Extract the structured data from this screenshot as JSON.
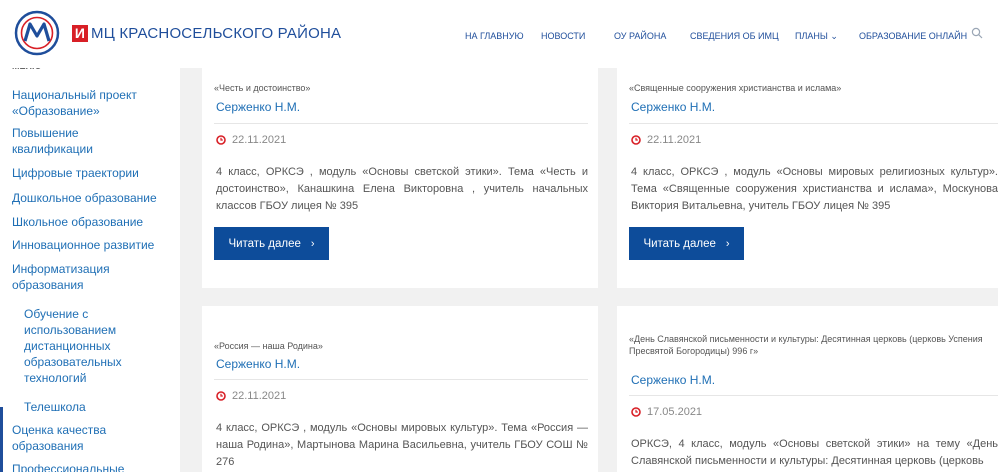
{
  "header": {
    "logo_mark": "И",
    "logo_text": "МЦ КРАСНОСЕЛЬСКОГО РАЙОНА",
    "nav": [
      "НА ГЛАВНУЮ",
      "НОВОСТИ",
      "ОУ РАЙОНА",
      "СВЕДЕНИЯ ОБ ИМЦ",
      "ПЛАНЫ ⌄",
      "ОБРАЗОВАНИЕ ОНЛАЙН"
    ],
    "search_icon": "search-icon"
  },
  "sidebar": {
    "title": "МЕНЮ",
    "items": [
      "Национальный проект «Образование»",
      "Повышение квалификации",
      "Цифровые траектории",
      "Дошкольное образование",
      "Школьное образование",
      "Инновационное развитие",
      "Информатизация образования",
      "Обучение с использованием дистанционных образовательных технологий",
      "Телешкола",
      "Оценка качества образования",
      "Профессиональные"
    ]
  },
  "cards": [
    {
      "category": "«Честь и достоинство»",
      "author": "Серженко Н.М.",
      "date": "22.11.2021",
      "text": "4 класс, ОРКСЭ , модуль «Основы светской этики». Тема «Честь и достоинство», Канашкина Елена Викторовна , учитель начальных классов ГБОУ лицея № 395",
      "button": "Читать далее"
    },
    {
      "category": "«Священные сооружения христианства и ислама»",
      "author": "Серженко Н.М.",
      "date": "22.11.2021",
      "text": "4 класс, ОРКСЭ , модуль «Основы мировых религиозных культур». Тема «Священные сооружения христианства и ислама», Москунова Виктория Витальевна, учитель ГБОУ лицея № 395",
      "button": "Читать далее"
    },
    {
      "category": "«Россия — наша Родина»",
      "author": "Серженко Н.М.",
      "date": "22.11.2021",
      "text": "4 класс, ОРКСЭ , модуль «Основы мировых культур». Тема «Россия — наша Родина», Мартынова Марина Васильевна, учитель ГБОУ СОШ № 276"
    },
    {
      "category": "«День Славянской письменности и культуры: Десятинная церковь (церковь Успения Пресвятой Богородицы) 996 г»",
      "author": "Серженко Н.М.",
      "date": "17.05.2021",
      "text": "ОРКСЭ, 4 класс, модуль «Основы светской этики» на тему «День Славянской письменности и культуры: Десятинная церковь (церковь"
    }
  ],
  "colors": {
    "brand": "#1f4e9b",
    "link": "#1f6fb5",
    "button": "#0d4c9a",
    "accent_red": "#d81f26",
    "date_icon": "#d81f26"
  }
}
